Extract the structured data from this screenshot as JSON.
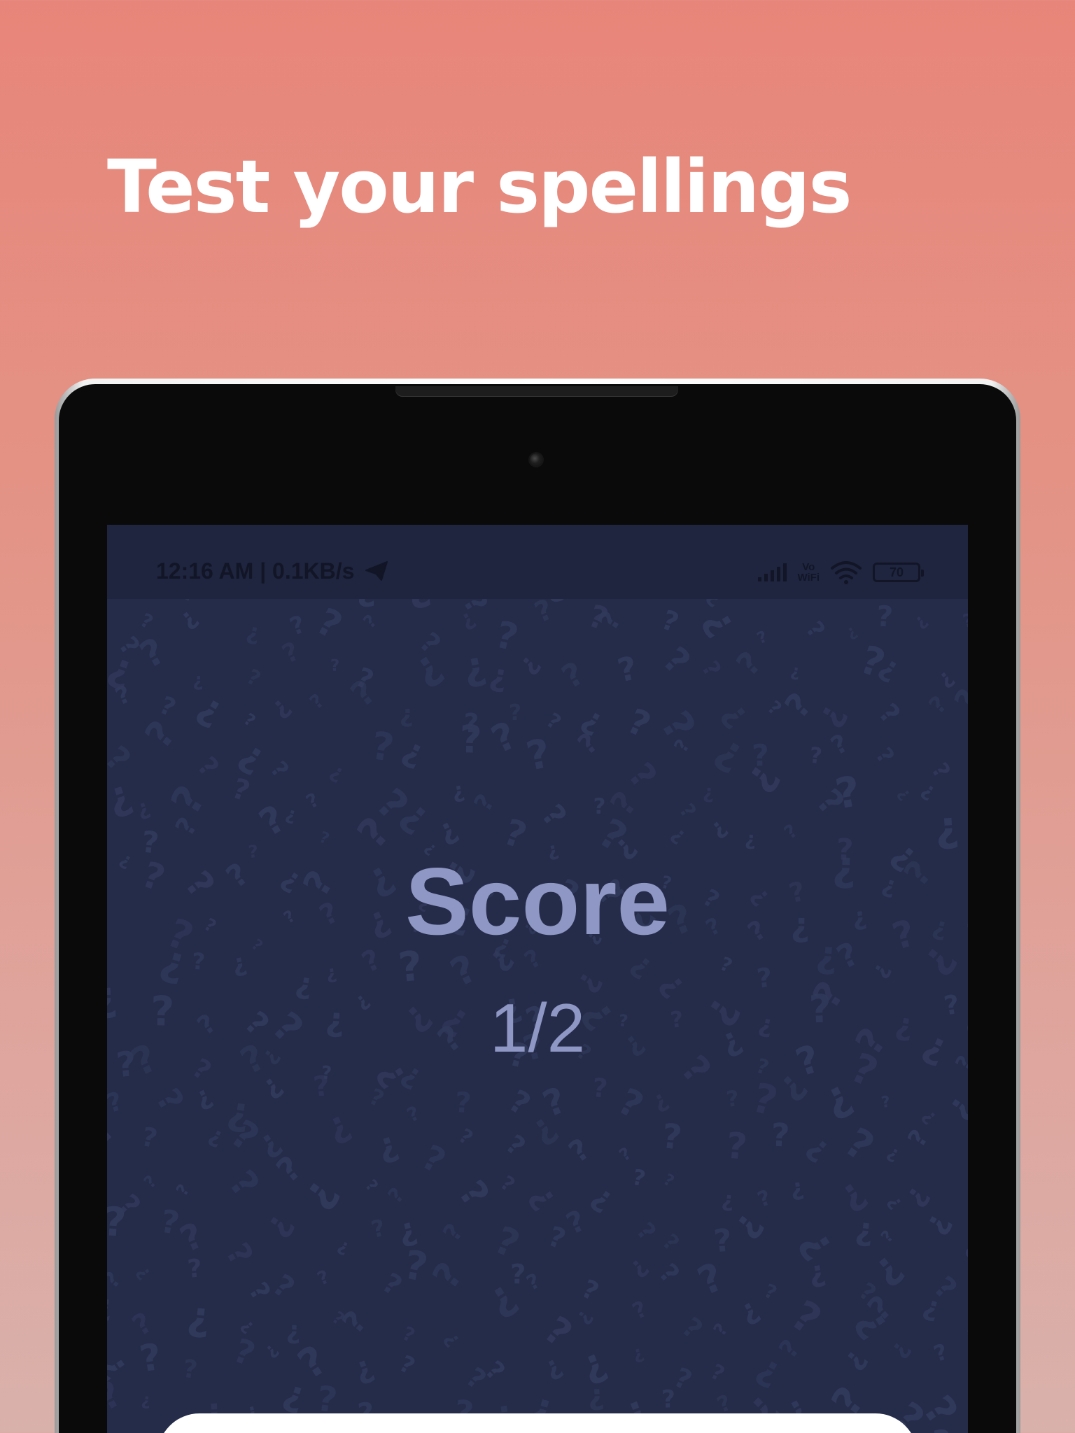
{
  "promo": {
    "headline": "Test your spellings"
  },
  "status_bar": {
    "left_text": "12:16 AM | 0.1KB/s",
    "battery_level": "70",
    "vowifi_label_top": "Vo",
    "vowifi_label_bottom": "WiFi"
  },
  "screen": {
    "score_title": "Score",
    "score_value": "1/2"
  },
  "colors": {
    "background_top": "#e8857a",
    "background_bottom": "#d9b1ab",
    "screen_bg": "#252c4a",
    "score_text": "#8f97c4"
  },
  "icons": [
    "send-icon",
    "signal-icon",
    "vowifi-icon",
    "wifi-icon",
    "battery-icon",
    "question-mark-pattern"
  ]
}
